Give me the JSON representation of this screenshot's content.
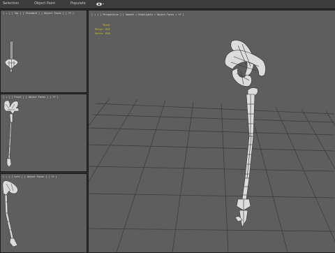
{
  "menu": {
    "items": [
      "Selection",
      "Object Paint",
      "Populate"
    ],
    "icons": [
      "eye-icon"
    ]
  },
  "viewports": {
    "top": {
      "label": "[ + ] [ Top ] [ Standard ] [ Object Faces ] [ ff ]"
    },
    "front": {
      "label": "[ + ] [ Front ] [ Object Faces ] [ ff ]"
    },
    "left": {
      "label": "[ + ] [ Left ] [ Object Faces ] [ ff ]"
    },
    "perspective": {
      "label": "[ + ] [ Perspective ] [ Smooth + Highlights + Object Faces + ff ]"
    }
  },
  "stats": {
    "total_label": "Total",
    "polys": "Polys: 612",
    "verts": "Verts: 638"
  },
  "colors": {
    "viewport_bg": "#5e5e5e",
    "grid": "#383838",
    "mesh_fill": "#d9d9d9",
    "wire": "#303030",
    "stats_text": "#e6d31f",
    "active_border": "#1e1e1e"
  }
}
